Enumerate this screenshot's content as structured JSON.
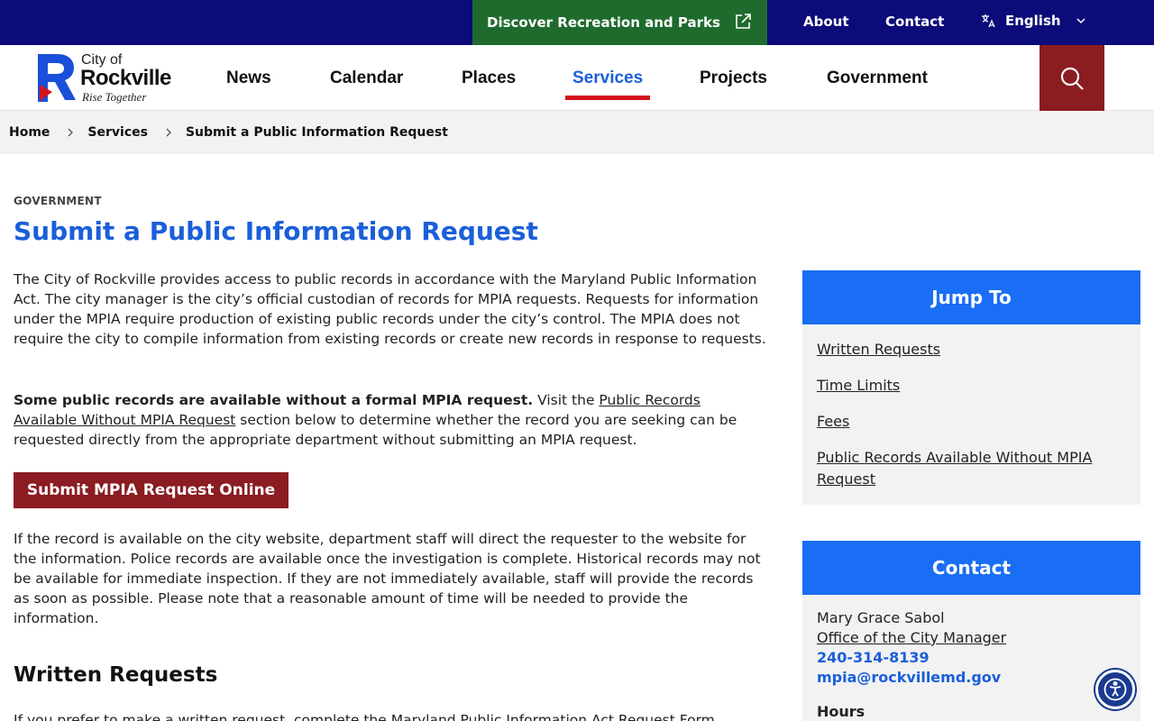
{
  "topbar": {
    "recreation_label": "Discover Recreation and Parks",
    "about_label": "About",
    "contact_label": "Contact",
    "language_label": "English"
  },
  "logo": {
    "city_of": "City of",
    "name": "Rockville",
    "tagline": "Rise Together"
  },
  "nav": {
    "items": [
      "News",
      "Calendar",
      "Places",
      "Services",
      "Projects",
      "Government"
    ],
    "active": "Services"
  },
  "breadcrumb": [
    "Home",
    "Services",
    "Submit a Public Information Request"
  ],
  "main": {
    "eyebrow": "GOVERNMENT",
    "title": "Submit a Public Information Request",
    "p1": "The City of Rockville provides access to public records in accordance with the Maryland Public Information Act. The city manager is the city’s official custodian of records for MPIA requests. Requests for information under the MPIA require production of existing public records under the city’s control. The MPIA does not require the city to compile information from existing records or create new records in response to requests.",
    "p2_bold": "Some public records are available without a formal MPIA request.",
    "p2_pre": " Visit the ",
    "p2_link": "Public Records Available Without MPIA Request",
    "p2_post": " section below to determine whether the record you are seeking can be requested directly from the appropriate department without submitting an MPIA request.",
    "button_label": "Submit MPIA Request Online",
    "p3": "If the record is available on the city website, department staff will direct the requester to the website for the information. Police records are available once the investigation is complete. Historical records may not be available for immediate inspection. If they are not immediately available, staff will provide the records as soon as possible. Please note that a reasonable amount of time will be needed to provide the information.",
    "section_heading": "Written Requests",
    "p4_partial": "If you prefer to make a written request, complete the Maryland Public Information Act Request Form"
  },
  "jump_to": {
    "heading": "Jump To",
    "links": [
      "Written Requests",
      "Time Limits",
      "Fees",
      "Public Records Available Without MPIA Request"
    ]
  },
  "contact": {
    "heading": "Contact",
    "name": "Mary Grace Sabol",
    "office": "Office of the City Manager",
    "phone": "240-314-8139",
    "email": "mpia@rockvillemd.gov",
    "hours_label": "Hours"
  },
  "colors": {
    "top_bar": "#0b0b7a",
    "recreation_green": "#1f6b2e",
    "accent_blue": "#1a5fd9",
    "brand_red": "#8a1c22",
    "active_underline": "#d4141c"
  }
}
